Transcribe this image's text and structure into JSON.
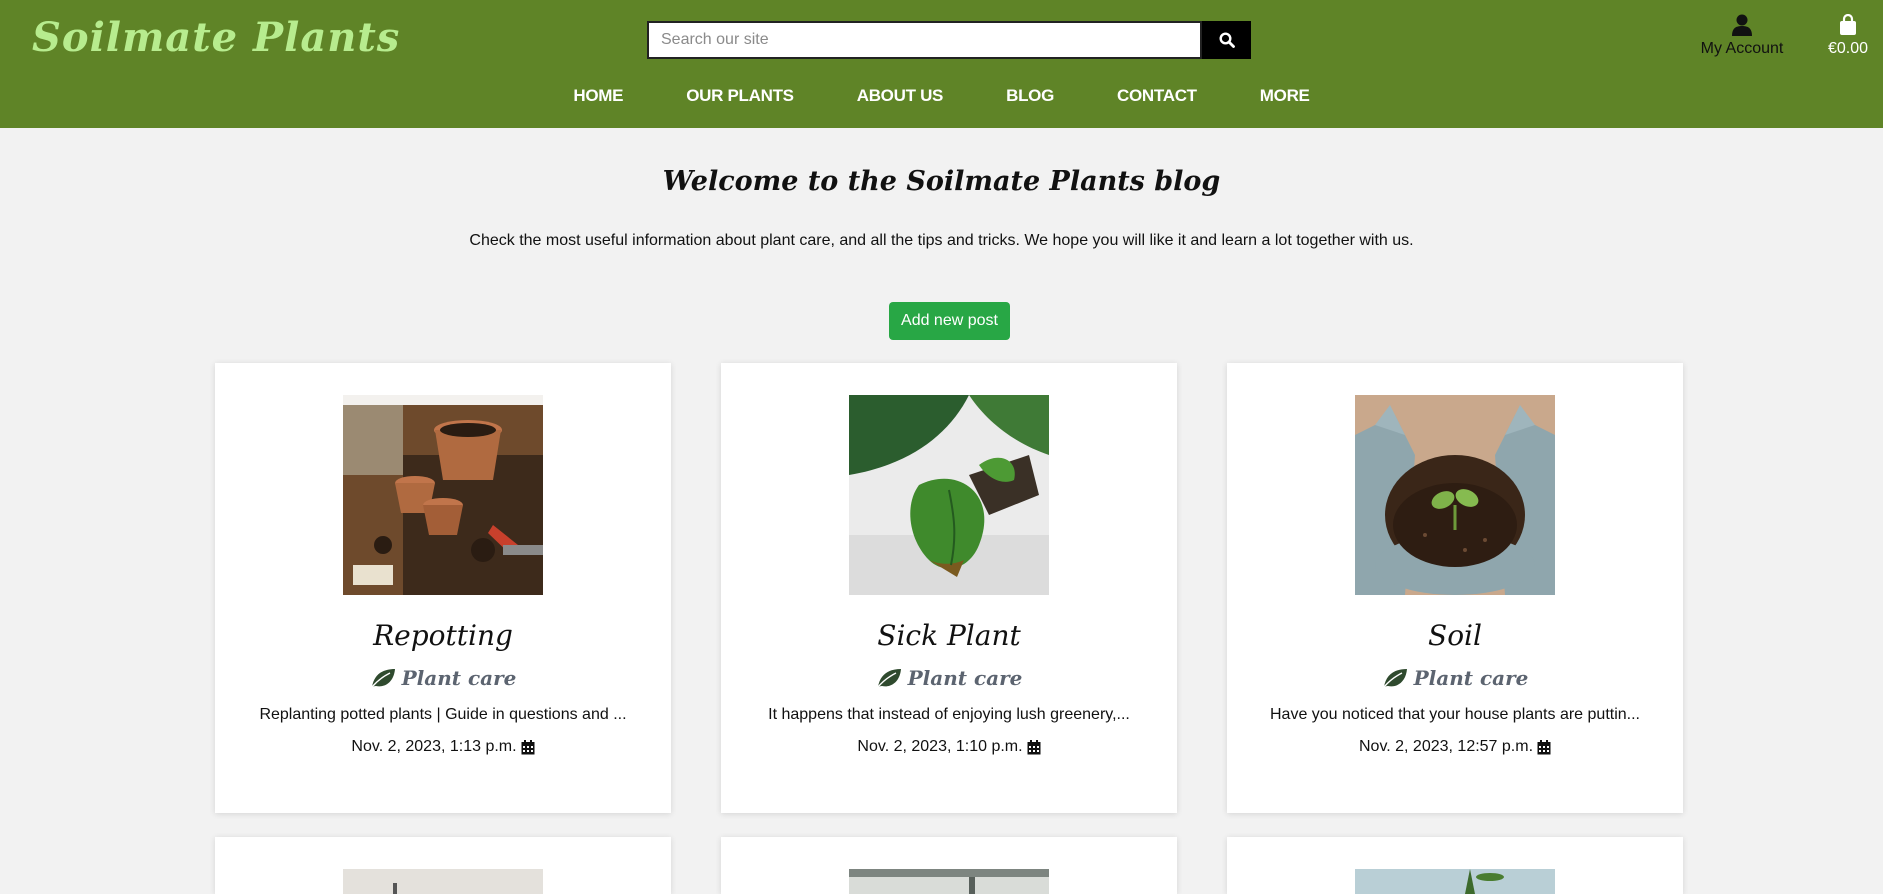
{
  "header": {
    "logo": "Soilmate Plants",
    "search_placeholder": "Search our site",
    "account_label": "My Account",
    "bag_total": "€0.00"
  },
  "nav": [
    "HOME",
    "OUR PLANTS",
    "ABOUT US",
    "BLOG",
    "CONTACT",
    "MORE"
  ],
  "intro": {
    "title": "Welcome to the Soilmate Plants blog",
    "text": "Check the most useful information about plant care, and all the tips and tricks. We hope you will like it and learn a lot together with us."
  },
  "add_post_label": "Add new post",
  "posts": [
    {
      "title": "Repotting",
      "category": "Plant care",
      "excerpt": "Replanting potted plants | Guide in questions and ...",
      "date": "Nov. 2, 2023, 1:13 p.m."
    },
    {
      "title": "Sick Plant",
      "category": "Plant care",
      "excerpt": "It happens that instead of enjoying lush greenery,...",
      "date": "Nov. 2, 2023, 1:10 p.m."
    },
    {
      "title": "Soil",
      "category": "Plant care",
      "excerpt": "Have you noticed that your house plants are puttin...",
      "date": "Nov. 2, 2023, 12:57 p.m."
    }
  ],
  "colors": {
    "header_bg": "#5f8427",
    "logo": "#b7ec8e",
    "add_button": "#28a745",
    "category_text": "#5c6470",
    "leaf_icon": "#2f4a2e"
  }
}
